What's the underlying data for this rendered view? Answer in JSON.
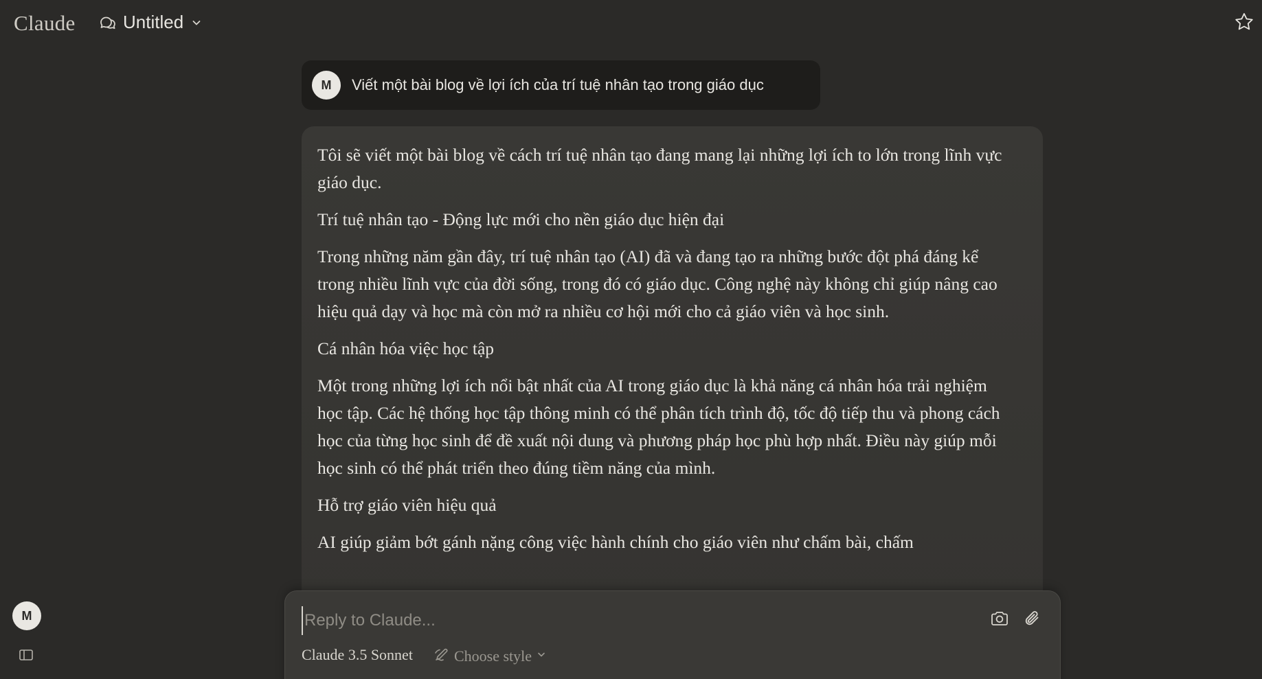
{
  "header": {
    "logo": "Claude",
    "title": "Untitled"
  },
  "user": {
    "initial": "M",
    "message": "Viết một bài blog về lợi ích của trí tuệ nhân tạo trong giáo dục"
  },
  "assistant": {
    "paragraphs": [
      "Tôi sẽ viết một bài blog về cách trí tuệ nhân tạo đang mang lại những lợi ích to lớn trong lĩnh vực giáo dục.",
      "Trí tuệ nhân tạo - Động lực mới cho nền giáo dục hiện đại",
      "Trong những năm gần đây, trí tuệ nhân tạo (AI) đã và đang tạo ra những bước đột phá đáng kể trong nhiều lĩnh vực của đời sống, trong đó có giáo dục. Công nghệ này không chỉ giúp nâng cao hiệu quả dạy và học mà còn mở ra nhiều cơ hội mới cho cả giáo viên và học sinh.",
      "Cá nhân hóa việc học tập",
      "Một trong những lợi ích nổi bật nhất của AI trong giáo dục là khả năng cá nhân hóa trải nghiệm học tập. Các hệ thống học tập thông minh có thể phân tích trình độ, tốc độ tiếp thu và phong cách học của từng học sinh để đề xuất nội dung và phương pháp học phù hợp nhất. Điều này giúp mỗi học sinh có thể phát triển theo đúng tiềm năng của mình.",
      "Hỗ trợ giáo viên hiệu quả",
      "AI giúp giảm bớt gánh nặng công việc hành chính cho giáo viên như chấm bài, chấm"
    ]
  },
  "composer": {
    "placeholder": "Reply to Claude...",
    "model": "Claude 3.5 Sonnet",
    "style": "Choose style"
  },
  "sidebar": {
    "user_initial": "M"
  },
  "icons": {
    "chat": "chat-bubbles-icon",
    "chevron": "chevron-down-icon",
    "star": "star-icon",
    "camera": "camera-icon",
    "attach": "paperclip-icon",
    "style": "pen-style-icon",
    "sidebar": "sidebar-toggle-icon"
  },
  "colors": {
    "background": "#2b2a28",
    "user_bubble": "#1e1d1b",
    "assistant_bubble": "#393835",
    "composer": "#3a3936",
    "text": "#e8e6e1",
    "muted": "#9b9891"
  }
}
